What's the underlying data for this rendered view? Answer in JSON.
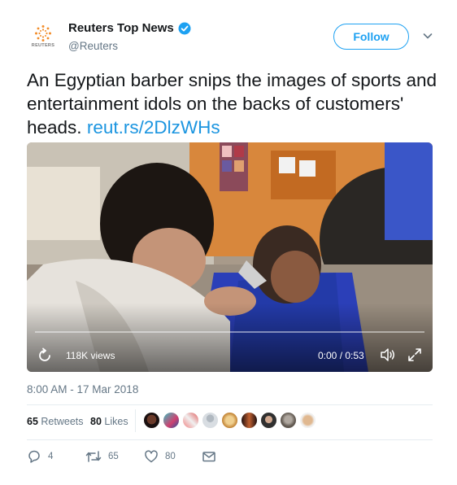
{
  "account": {
    "display_name": "Reuters Top News",
    "handle": "@Reuters",
    "avatar_text": "REUTERS",
    "verified_icon": "verified-badge-icon"
  },
  "follow_label": "Follow",
  "tweet": {
    "text": "An Egyptian barber snips the images of sports and entertainment idols on the backs of customers' heads.",
    "link_text": "reut.rs/2DlzWHs"
  },
  "video": {
    "views": "118K views",
    "time": "0:00 / 0:53",
    "progress": 0
  },
  "timestamp": "8:00 AM - 17 Mar 2018",
  "stats": {
    "retweets_count": "65",
    "retweets_label": "Retweets",
    "likes_count": "80",
    "likes_label": "Likes"
  },
  "actions": {
    "reply_count": "4",
    "retweet_count": "65",
    "like_count": "80"
  },
  "colors": {
    "accent": "#1da1f2",
    "link": "#1b95e0",
    "muted": "#657786",
    "reuters_orange": "#f28c28"
  }
}
